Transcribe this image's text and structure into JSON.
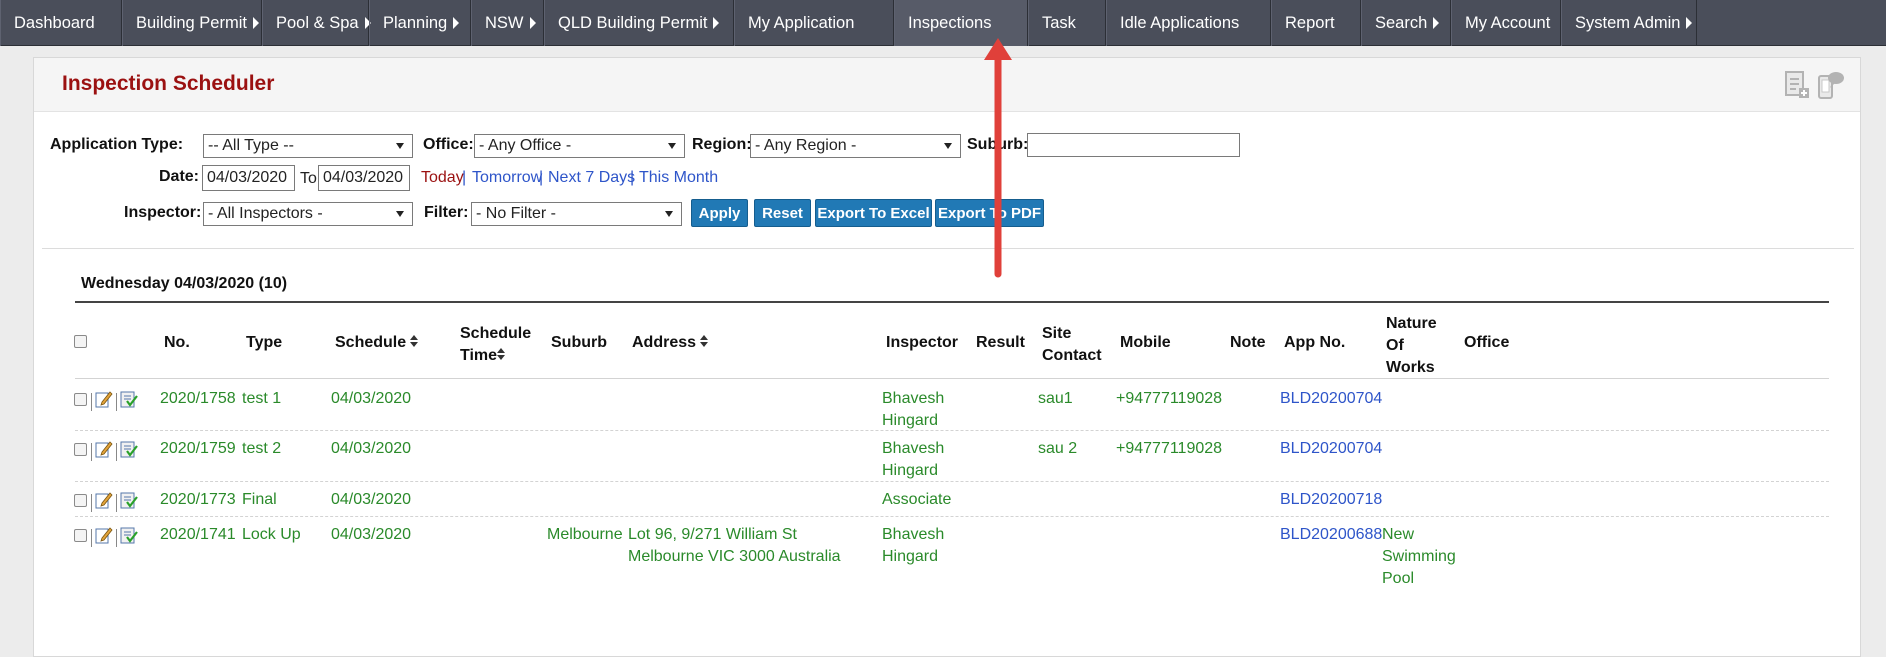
{
  "nav": {
    "items": [
      {
        "label": "Dashboard",
        "caret": false
      },
      {
        "label": "Building Permit",
        "caret": true
      },
      {
        "label": "Pool & Spa",
        "caret": true
      },
      {
        "label": "Planning",
        "caret": true
      },
      {
        "label": "NSW",
        "caret": true
      },
      {
        "label": "QLD Building Permit",
        "caret": true
      },
      {
        "label": "My Application",
        "caret": false
      },
      {
        "label": "Inspections",
        "caret": false
      },
      {
        "label": "Task",
        "caret": false
      },
      {
        "label": "Idle Applications",
        "caret": false
      },
      {
        "label": "Report",
        "caret": false
      },
      {
        "label": "Search",
        "caret": true
      },
      {
        "label": "My Account",
        "caret": false
      },
      {
        "label": "System Admin",
        "caret": true
      }
    ]
  },
  "page": {
    "title": "Inspection Scheduler"
  },
  "filters": {
    "application_type_label": "Application Type:",
    "application_type_value": "-- All Type --",
    "office_label": "Office:",
    "office_value": "- Any Office -",
    "region_label": "Region:",
    "region_value": "- Any Region -",
    "suburb_label": "Suburb:",
    "suburb_value": "",
    "date_label": "Date:",
    "date_from": "04/03/2020",
    "to_label": "To",
    "date_to": "04/03/2020",
    "quick_today": "Today",
    "quick_tomorrow": "Tomorrow",
    "quick_next7": "Next 7 Days",
    "quick_month": "This Month",
    "separator": "|",
    "inspector_label": "Inspector:",
    "inspector_value": "- All Inspectors -",
    "filter_label": "Filter:",
    "filter_value": "- No Filter -"
  },
  "buttons": {
    "apply": "Apply",
    "reset": "Reset",
    "excel": "Export To Excel",
    "pdf": "Export To PDF"
  },
  "schedule": {
    "day_heading": "Wednesday 04/03/2020 (10)",
    "columns": {
      "no": "No.",
      "type": "Type",
      "schedule": "Schedule",
      "schedule_time": "Schedule Time",
      "suburb": "Suburb",
      "address": "Address",
      "inspector": "Inspector",
      "result": "Result",
      "site_contact": "Site Contact",
      "mobile": "Mobile",
      "note": "Note",
      "app_no": "App No.",
      "nature": "Nature Of Works",
      "office": "Office"
    },
    "rows": [
      {
        "no": "2020/1758",
        "type": "test 1",
        "schedule": "04/03/2020",
        "time": "",
        "suburb": "",
        "address": "",
        "inspector": "Bhavesh Hingard",
        "result": "",
        "site_contact": "sau1",
        "mobile": "+94777119028",
        "note": "",
        "app_no": "BLD20200704",
        "nature": "",
        "office": ""
      },
      {
        "no": "2020/1759",
        "type": "test 2",
        "schedule": "04/03/2020",
        "time": "",
        "suburb": "",
        "address": "",
        "inspector": "Bhavesh Hingard",
        "result": "",
        "site_contact": "sau 2",
        "mobile": "+94777119028",
        "note": "",
        "app_no": "BLD20200704",
        "nature": "",
        "office": ""
      },
      {
        "no": "2020/1773",
        "type": "Final",
        "schedule": "04/03/2020",
        "time": "",
        "suburb": "",
        "address": "",
        "inspector": "Associate",
        "result": "",
        "site_contact": "",
        "mobile": "",
        "note": "",
        "app_no": "BLD20200718",
        "nature": "",
        "office": ""
      },
      {
        "no": "2020/1741",
        "type": "Lock Up",
        "schedule": "04/03/2020",
        "time": "",
        "suburb": "Melbourne",
        "address": "Lot 96, 9/271 William St Melbourne VIC 3000 Australia",
        "inspector": "Bhavesh Hingard",
        "result": "",
        "site_contact": "",
        "mobile": "",
        "note": "",
        "app_no": "BLD20200688",
        "nature": "New Swimming Pool",
        "office": ""
      }
    ]
  },
  "colors": {
    "nav_bg": "#4a4e5a",
    "title": "#9b1111",
    "button": "#2179b5",
    "row_text": "#2a8a2a",
    "link": "#2e55c9",
    "today": "#9b1111",
    "annotation_arrow": "#e0403a"
  }
}
